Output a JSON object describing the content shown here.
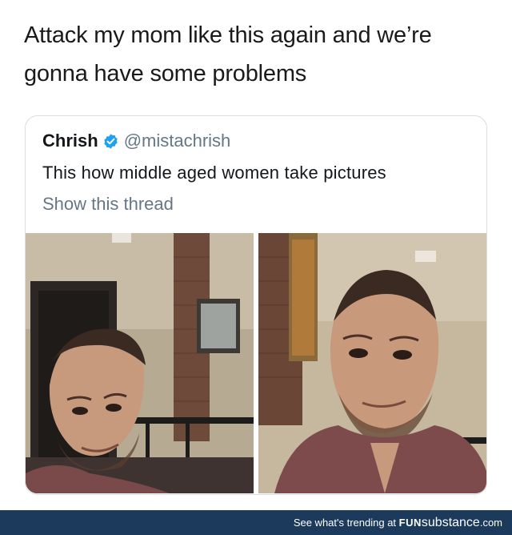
{
  "caption": "Attack my mom like this again and we’re gonna have some problems",
  "tweet": {
    "name": "Chrish",
    "handle": "@mistachrish",
    "text": "This how middle aged women take pictures",
    "show_thread": "Show this thread"
  },
  "footer": {
    "prompt": "See what's trending at",
    "brand_fun": "FUN",
    "brand_sub": "substance",
    "brand_com": ".com"
  },
  "colors": {
    "verified": "#1da1f2",
    "handle": "#657786",
    "footer_bg": "#1b3a5c"
  }
}
